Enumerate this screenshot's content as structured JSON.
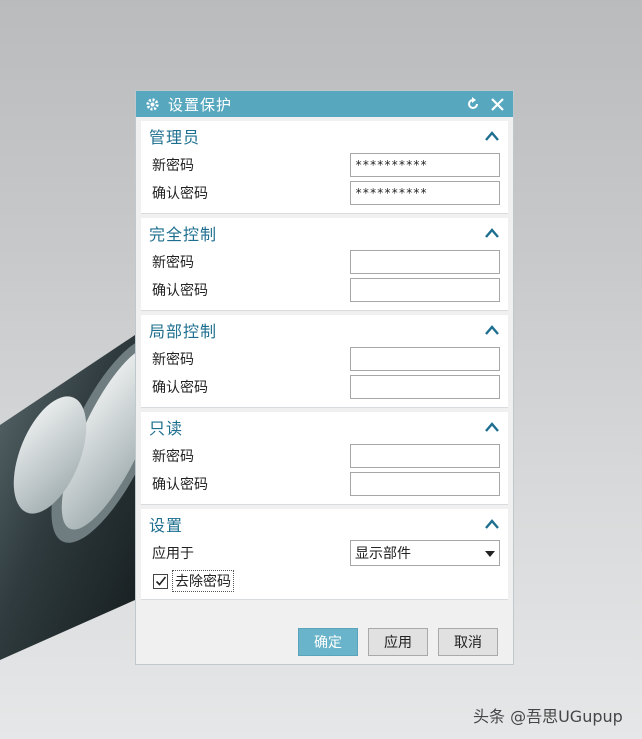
{
  "dialog": {
    "title": "设置保护",
    "sections": [
      {
        "title": "管理员",
        "rows": [
          {
            "label": "新密码",
            "value": "**********"
          },
          {
            "label": "确认密码",
            "value": "**********"
          }
        ]
      },
      {
        "title": "完全控制",
        "rows": [
          {
            "label": "新密码",
            "value": ""
          },
          {
            "label": "确认密码",
            "value": ""
          }
        ]
      },
      {
        "title": "局部控制",
        "rows": [
          {
            "label": "新密码",
            "value": ""
          },
          {
            "label": "确认密码",
            "value": ""
          }
        ]
      },
      {
        "title": "只读",
        "rows": [
          {
            "label": "新密码",
            "value": ""
          },
          {
            "label": "确认密码",
            "value": ""
          }
        ]
      }
    ],
    "settings": {
      "title": "设置",
      "apply_to_label": "应用于",
      "apply_to_value": "显示部件",
      "remove_password_label": "去除密码",
      "remove_password_checked": true
    },
    "buttons": {
      "ok": "确定",
      "apply": "应用",
      "cancel": "取消"
    }
  },
  "watermark": "头条 @吾思UGupup",
  "icons": [
    "gear-icon",
    "reset-icon",
    "close-icon",
    "chevron-up-icon",
    "dropdown-arrow-icon",
    "check-icon"
  ],
  "colors": {
    "title_bar": "#57a7bf",
    "section_title": "#1e6f8f",
    "primary_button": "#69b4ca"
  }
}
